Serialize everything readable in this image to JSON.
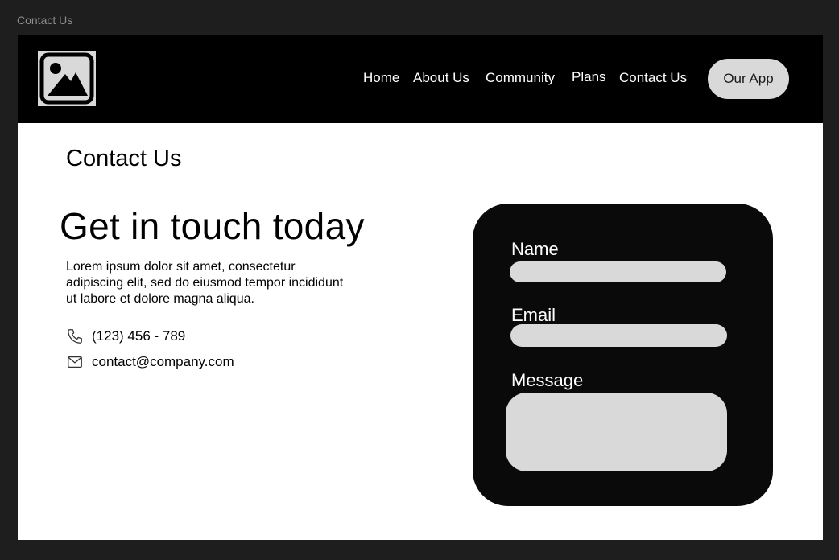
{
  "canvas": {
    "frame_label": "Contact Us"
  },
  "colors": {
    "canvas_bg": "#1e1e1e",
    "nav_bg": "#000000",
    "pill_bg": "#d9d9d9",
    "form_bg": "#0a0a0a",
    "page_bg": "#ffffff"
  },
  "nav": {
    "logo_icon": "image-placeholder-icon",
    "links": [
      "Home",
      "About Us",
      "Community",
      "Plans",
      "Contact Us"
    ],
    "cta_label": "Our App"
  },
  "page": {
    "title": "Contact Us",
    "headline": "Get in touch today",
    "intro": "Lorem ipsum dolor sit amet, consectetur adipiscing elit, sed do eiusmod tempor incididunt ut labore et dolore magna aliqua.",
    "phone_icon": "phone-icon",
    "phone": "(123) 456 - 789",
    "email_icon": "mail-icon",
    "email": "contact@company.com"
  },
  "form": {
    "name_label": "Name",
    "name_value": "",
    "email_label": "Email",
    "email_value": "",
    "message_label": "Message",
    "message_value": ""
  }
}
